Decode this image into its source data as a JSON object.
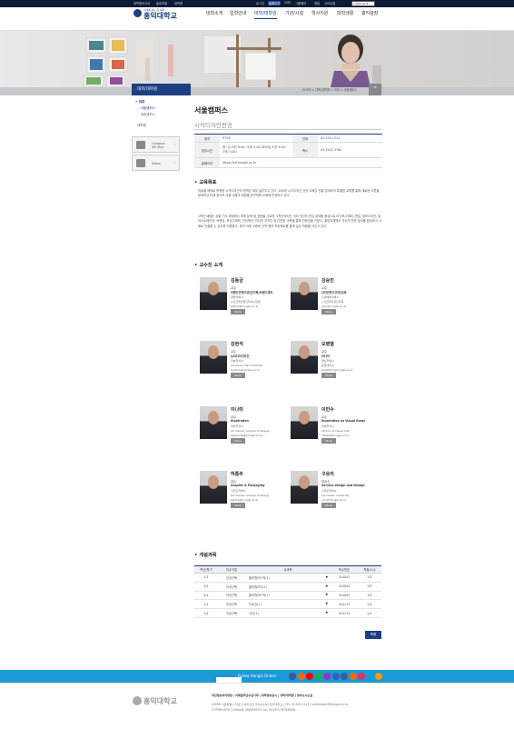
{
  "topbar": {
    "left_links": [
      "대학원보고서",
      "홍대포털",
      "대학원"
    ],
    "right_links": [
      "로그인",
      "홈페이지",
      "CMS",
      "그룹웨어",
      "메일",
      "사이트맵"
    ],
    "lang_value": "LANGUAGE"
  },
  "header": {
    "logo_sub": "미래를 여는 큰 대학",
    "logo_name": "홍익대학교",
    "nav": [
      "대학소개",
      "입학안내",
      "대학/대학원",
      "기관/시설",
      "학사지원",
      "대학생활",
      "홍익광장"
    ]
  },
  "location": {
    "section_title": "대학/대학원",
    "path": "HOME > 대학/대학원 > 미대 > 서울캠퍼스",
    "up_symbol": "^"
  },
  "sidebar": {
    "items": [
      "미대",
      "서울캠퍼스",
      "세종캠퍼스",
      "대학원"
    ],
    "boxes": [
      {
        "label_1": "Campus",
        "label_2": "VR Tour",
        "arrow": "›"
      },
      {
        "label_1": "Video",
        "label_2": "",
        "arrow": "›"
      }
    ]
  },
  "main": {
    "campus": "서울캠퍼스",
    "department": "시각디자인전공",
    "info": [
      {
        "k1": "위치",
        "v1": "R709",
        "k2": "전화",
        "v2": "02-320-1214"
      },
      {
        "k1": "업무시간",
        "v1": "월~금 오전 9:00~오후 5:00 (토요일 오전 9:00~오후 1:00)",
        "k2": "팩스",
        "v2": "02-3142-5780"
      },
      {
        "k1": "홈페이지",
        "v1": "https://vd.hongik.ac.kr",
        "k2": "",
        "v2": ""
      }
    ],
    "goal_title": "교육목표",
    "goal_text": "미술을 매체로 활용한 시각디자인의 영역은 매우 넓어지고 있다. SNS와 시각디자인 전공 교육은 전통 분야와의 특별한 교류를 통해 새로운 이론을 탐색하고 미래 창의적 교육 내용과 방법을 탐구하며 교육에 반영하고 있다.",
    "goal_text_2": "1학년 때에는 공통 기초 과정에서 조형 능력 및 표현을 기르며, 2학년부터는 각자 자신의 관심 분야를 중심으로 타이포그래피, 편집, 정보디자인, 일러스트레이션, 브랜딩, 모션그래픽, 인터랙션, 미디어 디자인 등 다양한 과목을 통해 전문성을 키운다. 졸업과제에서 자신의 전문 분야를 완성하고 사회로 진출할 수 있도록 지원한다. 특히 국제 교류와 산학 협력 프로젝트를 통해 실무 역량을 키우고 있다."
  },
  "faculty_title": "교수진 소개",
  "faculty": [
    {
      "name": "김동균",
      "rank": "교수",
      "field": "브랜드전략/디자인기획/브랜드관리",
      "d1": "경영학박사",
      "d2": "(사)한국산업디자이너협회",
      "d3": "dkkim@hongik.ac.kr",
      "more": "More"
    },
    {
      "name": "김승인",
      "rank": "교수",
      "field": "디자인학/디자인교육",
      "d1": "조형예술학박사",
      "d2": "(사)한국디자인학회",
      "d3": "sijm@hongik.ac.kr",
      "more": "More"
    },
    {
      "name": "김현석",
      "rank": "교수",
      "field": "뉴미디어디자인",
      "d1": "미술학석사",
      "d2": "American Film Institute",
      "d3": "hyskim@hongik.ac.kr",
      "more": "More"
    },
    {
      "name": "오병열",
      "rank": "교수",
      "field": "미디어",
      "d1": "영상학박사",
      "d2": "중앙대학교",
      "d3": "byo0007@hongik.ac.kr",
      "more": "More"
    },
    {
      "name": "이나미",
      "rank": "교수",
      "field": "Illustration",
      "d1": "미술학석사",
      "d2": "Art Center College of Design",
      "d3": "leenami8@hongik.ac.kr",
      "more": "More"
    },
    {
      "name": "이민수",
      "rank": "교수",
      "field": "Illustration as Visual Essay",
      "d1": "미술학석사",
      "d2": "School of Visual Arts",
      "d3": "mslee@hongik.ac.kr",
      "more": "More"
    },
    {
      "name": "하종주",
      "rank": "교수",
      "field": "Graphic & Packaging",
      "d1": "디자인학박사",
      "d2": "Art Center College of Design",
      "d3": "jejuha@hongik.ac.kr",
      "more": "More"
    },
    {
      "name": "구유리",
      "rank": "부교수",
      "field": "Service design and Design",
      "d1": "디자인학박사",
      "d2": "Lancaster University",
      "d3": "yuri@hongik.ac.kr",
      "more": "More"
    }
  ],
  "courses_title": "개설과목",
  "course_headers": [
    "학년/학기",
    "이수구분",
    "교과목",
    "학수번호",
    "학점/시수"
  ],
  "courses": [
    {
      "term": "3/1",
      "type": "전공선택",
      "name": "플러월리드적(1)",
      "code": "410003",
      "credit": "3/3"
    },
    {
      "term": "4/1",
      "type": "전공선택",
      "name": "플러월리드(2)",
      "code": "410004",
      "credit": "3/3"
    },
    {
      "term": "4/1",
      "type": "전공선택",
      "name": "플러월리드적(1)",
      "code": "410005",
      "credit": "3/3"
    },
    {
      "term": "1/1",
      "type": "전공선택",
      "name": "드로잉(1)",
      "code": "410113",
      "credit": "2/2"
    },
    {
      "term": "1/1",
      "type": "전공선택",
      "name": "사진(1)",
      "code": "410115",
      "credit": "2/2"
    }
  ],
  "more_button": "목록",
  "follow": {
    "label": "Follow Hongik Online",
    "colors": [
      "#3b5998",
      "#ff6600",
      "#ff0000",
      "#1fb141",
      "#8a3ab9",
      "#2d65b2",
      "#3b5998",
      "#ff6600",
      "#e1306c",
      "#1b99d6",
      "#ff9900"
    ]
  },
  "footer": {
    "name": "홍익대학교",
    "links": "개인정보처리방침 | 이메일무단수집거부 | 대학정보공시 | 대학/대학원 | 찾아오시는길",
    "address": "04066 서울특별시 마포구 와우산로 94(상수동) 홍익대학교 | TEL 02-320-1114 | webmaster@hongik.ac.kr",
    "copyright": "COPYRIGHT(C) HONGIK UNIVERSITY. ALL RIGHTS RESERVED."
  }
}
